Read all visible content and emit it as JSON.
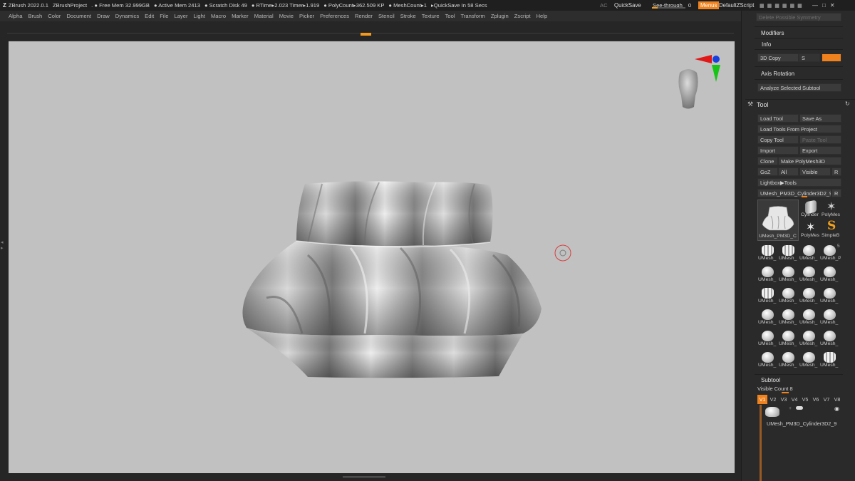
{
  "titlebar": {
    "app": "ZBrush 2022.0.1",
    "project": "ZBrushProject",
    "free_mem": ". ● Free Mem 32.999GB",
    "active_mem": "● Active Mem 2413",
    "scratch": "● Scratch Disk 49",
    "rtime": "● RTime▸2.023 Timer▸1.919",
    "polycount": "● PolyCount▸362.509 KP",
    "meshcount": "● MeshCount▸1",
    "quicksave_timer": "▸QuickSave In 58 Secs",
    "ac": "AC",
    "quicksave": "QuickSave",
    "see_through": "See-through",
    "see_through_value": "0",
    "menus": "Menus",
    "script": "DefaultZScript"
  },
  "menubar": [
    "Alpha",
    "Brush",
    "Color",
    "Document",
    "Draw",
    "Dynamics",
    "Edit",
    "File",
    "Layer",
    "Light",
    "Macro",
    "Marker",
    "Material",
    "Movie",
    "Picker",
    "Preferences",
    "Render",
    "Stencil",
    "Stroke",
    "Texture",
    "Tool",
    "Transform",
    "Zplugin",
    "Zscript",
    "Help"
  ],
  "panel": {
    "delete_symmetry": "Delete Possible Symmetry",
    "modifiers": "Modifiers",
    "info": "Info",
    "copy3d": "3D Copy",
    "copy3d_s": "S",
    "axis_rotation": "Axis Rotation",
    "analyze": "Analyze Selected Subtool",
    "tool_header": "Tool",
    "load_tool": "Load Tool",
    "save_as": "Save As",
    "load_from_project": "Load Tools From Project",
    "copy_tool": "Copy Tool",
    "paste_tool": "Paste Tool",
    "import": "Import",
    "export": "Export",
    "clone": "Clone",
    "make_polymesh": "Make PolyMesh3D",
    "goz": "GoZ",
    "all": "All",
    "visible": "Visible",
    "r": "R",
    "lightbox": "Lightbox▶Tools",
    "current_tool": "UMesh_PM3D_Cylinder3D2_9",
    "current_tool_r": "R",
    "big_label": "UMesh_PM3D_C",
    "cylinder": "Cylinder",
    "polymesh_1": "PolyMes",
    "polymesh_2": "PolyMes",
    "simpleb": "SimpleB",
    "badge_5": "5",
    "thumb_label_short": "UMesh_",
    "thumb_label_long": "UMesh_PM3D_C",
    "subtool_header": "Subtool",
    "visible_count": "Visible Count 8",
    "vtabs": [
      "V1",
      "V2",
      "V3",
      "V4",
      "V5",
      "V6",
      "V7",
      "V8"
    ],
    "subtool_name": "UMesh_PM3D_Cylinder3D2_9"
  },
  "colors": {
    "accent": "#f0821e",
    "canvas": "#c1c1c1",
    "panel": "#2a2a2a"
  }
}
